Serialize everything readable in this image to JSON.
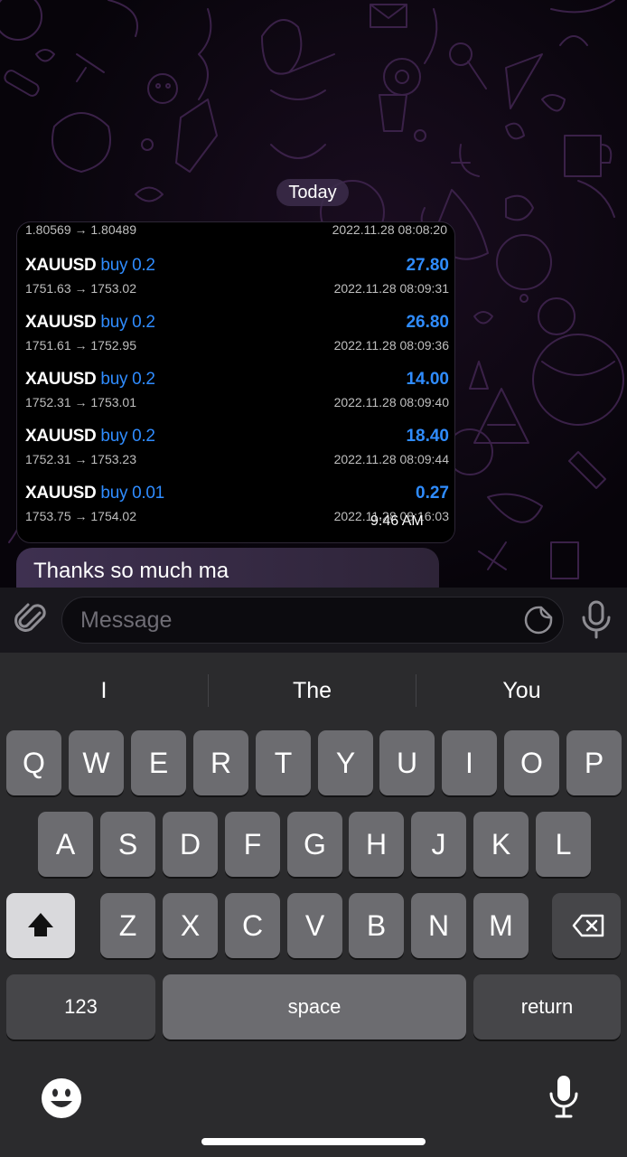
{
  "chat": {
    "date_separator": "Today",
    "trade_card": {
      "first_row": {
        "prices": "1.80569 → 1.80489",
        "time": "2022.11.28 08:08:20"
      },
      "rows": [
        {
          "symbol": "XAUUSD",
          "side": "buy 0.2",
          "profit": "27.80",
          "prices": "1751.63 → 1753.02",
          "time": "2022.11.28 08:09:31"
        },
        {
          "symbol": "XAUUSD",
          "side": "buy 0.2",
          "profit": "26.80",
          "prices": "1751.61 → 1752.95",
          "time": "2022.11.28 08:09:36"
        },
        {
          "symbol": "XAUUSD",
          "side": "buy 0.2",
          "profit": "14.00",
          "prices": "1752.31 → 1753.01",
          "time": "2022.11.28 08:09:40"
        },
        {
          "symbol": "XAUUSD",
          "side": "buy 0.2",
          "profit": "18.40",
          "prices": "1752.31 → 1753.23",
          "time": "2022.11.28 08:09:44"
        },
        {
          "symbol": "XAUUSD",
          "side": "buy 0.01",
          "profit": "0.27",
          "prices": "1753.75 → 1754.02",
          "time": "2022.11.28 08:16:03"
        }
      ],
      "sent_time": "9:46 AM"
    },
    "partial_message": "Thanks so much ma"
  },
  "input": {
    "placeholder": "Message"
  },
  "keyboard": {
    "suggestions": [
      "I",
      "The",
      "You"
    ],
    "row1": [
      "Q",
      "W",
      "E",
      "R",
      "T",
      "Y",
      "U",
      "I",
      "O",
      "P"
    ],
    "row2": [
      "A",
      "S",
      "D",
      "F",
      "G",
      "H",
      "J",
      "K",
      "L"
    ],
    "row3": [
      "Z",
      "X",
      "C",
      "V",
      "B",
      "N",
      "M"
    ],
    "numbers_label": "123",
    "space_label": "space",
    "return_label": "return"
  },
  "icons": {
    "attach": "paperclip-icon",
    "sticker": "sticker-icon",
    "mic": "microphone-icon",
    "shift": "shift-arrow-icon",
    "delete": "backspace-icon",
    "emoji": "emoji-icon",
    "dictation": "microphone-icon"
  },
  "colors": {
    "accent_blue": "#2f8cff",
    "bubble": "#3e3050",
    "doodle": "#3a2148"
  }
}
